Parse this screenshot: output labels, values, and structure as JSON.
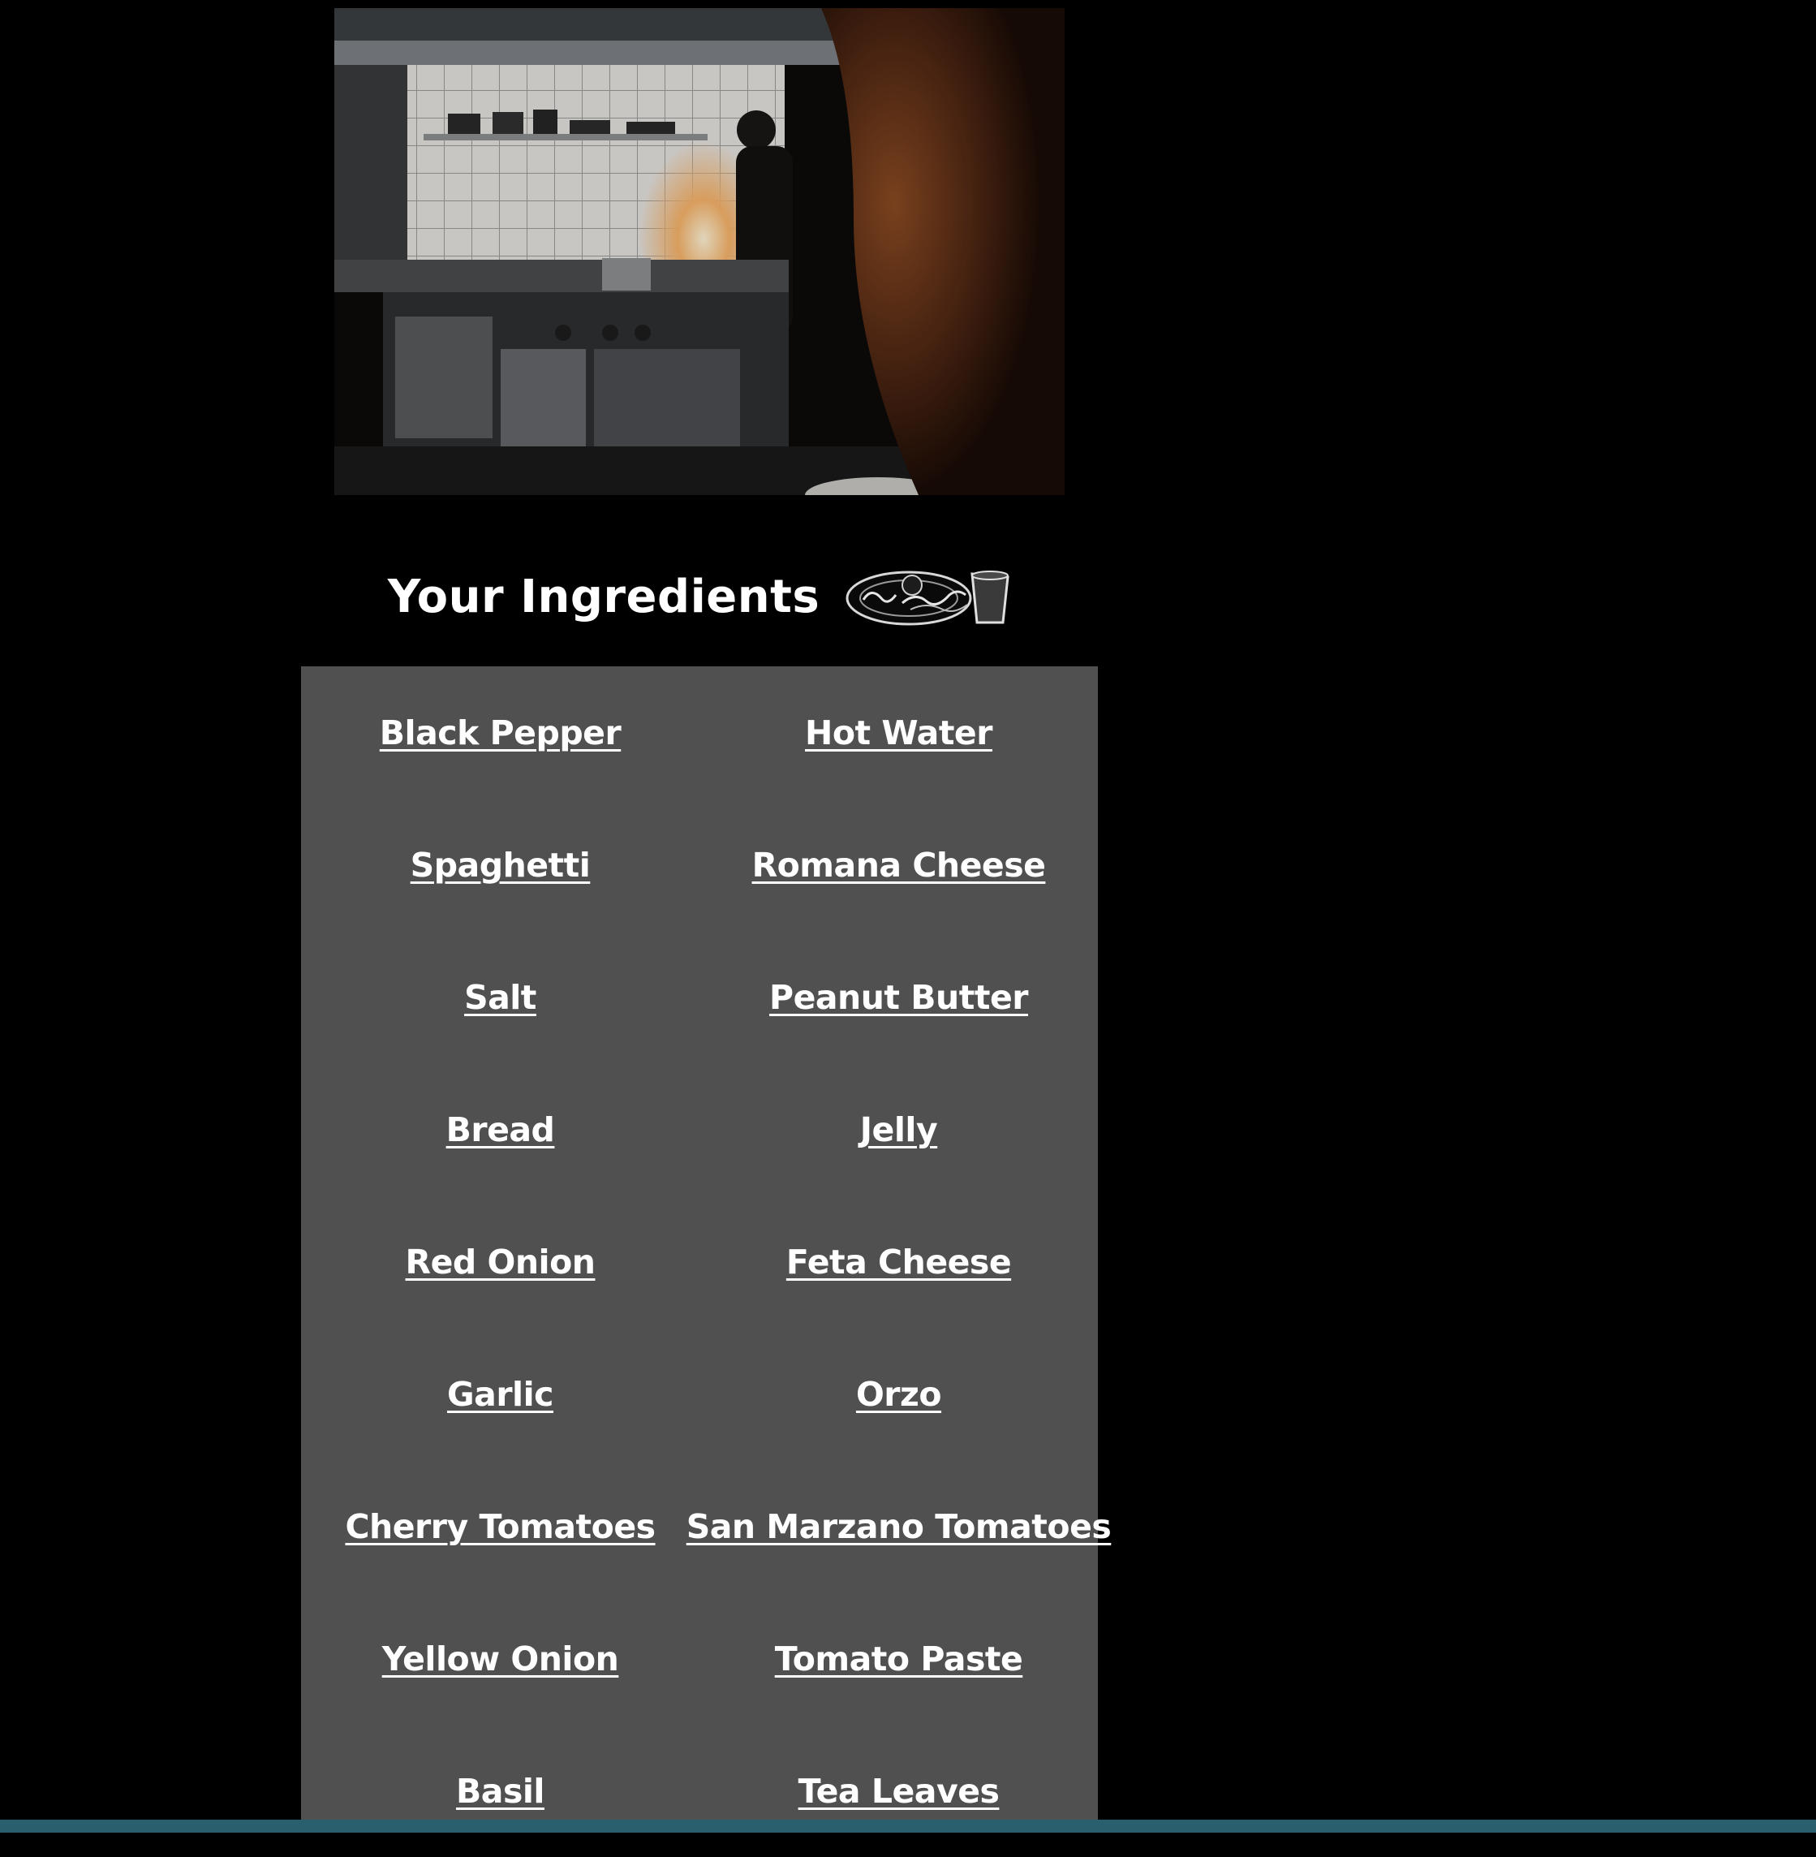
{
  "heading": {
    "title": "Your Ingredients"
  },
  "ingredients": [
    {
      "label": "Black Pepper"
    },
    {
      "label": "Hot Water"
    },
    {
      "label": "Spaghetti"
    },
    {
      "label": "Romana Cheese"
    },
    {
      "label": "Salt"
    },
    {
      "label": "Peanut Butter"
    },
    {
      "label": "Bread"
    },
    {
      "label": "Jelly"
    },
    {
      "label": "Red Onion"
    },
    {
      "label": "Feta Cheese"
    },
    {
      "label": "Garlic"
    },
    {
      "label": "Orzo"
    },
    {
      "label": "Cherry Tomatoes"
    },
    {
      "label": "San Marzano Tomatoes"
    },
    {
      "label": "Yellow Onion"
    },
    {
      "label": "Tomato Paste"
    },
    {
      "label": "Basil"
    },
    {
      "label": "Tea Leaves"
    }
  ],
  "icons": {
    "hero": "kitchen-photo",
    "heading": "plate-and-cup-icon"
  },
  "colors": {
    "page_background": "#000000",
    "panel_background": "#505050",
    "link_text": "#ffffff",
    "bottom_bar": "#2a5f6d"
  }
}
